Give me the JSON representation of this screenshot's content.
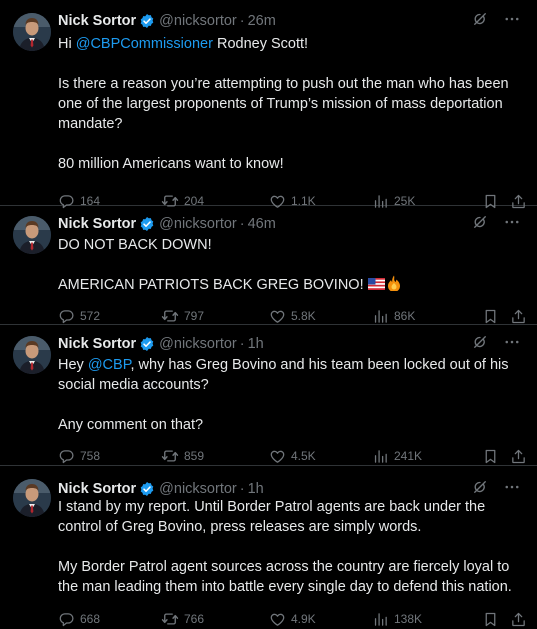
{
  "tweets": [
    {
      "name": "Nick Sortor",
      "handle": "@nicksortor",
      "time": "26m",
      "mention": "@CBPCommissioner",
      "text_after_mention": " Rodney Scott!\n\nIs there a reason you’re attempting to push out the man who has been one of the largest proponents of Trump’s mission of mass deportation mandate?\n\n80 million Americans want to know!",
      "text_before_mention": "Hi ",
      "replies": "164",
      "reposts": "204",
      "likes": "1.1K",
      "views": "25K"
    },
    {
      "name": "Nick Sortor",
      "handle": "@nicksortor",
      "time": "46m",
      "text": "DO NOT BACK DOWN!\n\nAMERICAN PATRIOTS BACK GREG BOVINO!",
      "replies": "572",
      "reposts": "797",
      "likes": "5.8K",
      "views": "86K"
    },
    {
      "name": "Nick Sortor",
      "handle": "@nicksortor",
      "time": "1h",
      "text_before_mention": "Hey ",
      "mention": "@CBP",
      "text_after_mention": ", why has Greg Bovino and his team been locked out of his social media accounts?\n\nAny comment on that?",
      "replies": "758",
      "reposts": "859",
      "likes": "4.5K",
      "views": "241K"
    },
    {
      "name": "Nick Sortor",
      "handle": "@nicksortor",
      "time": "1h",
      "text": "I stand by my report. Until Border Patrol agents are back under the control of Greg Bovino, press releases are simply words.\n\nMy Border Patrol agent sources across the country are fiercely loyal to the man leading them into battle every single day to defend this nation.",
      "replies": "668",
      "reposts": "766",
      "likes": "4.9K",
      "views": "138K"
    }
  ],
  "colors": {
    "background": "#000000",
    "text": "#e7e9ea",
    "muted": "#71767b",
    "link": "#1d9bf0",
    "verified": "#1d9bf0",
    "divider": "#2f3336"
  },
  "icons": [
    "verified-badge-icon",
    "grok-icon",
    "more-icon",
    "reply-icon",
    "repost-icon",
    "like-icon",
    "views-icon",
    "bookmark-icon",
    "share-icon",
    "us-flag-emoji",
    "fire-emoji"
  ]
}
